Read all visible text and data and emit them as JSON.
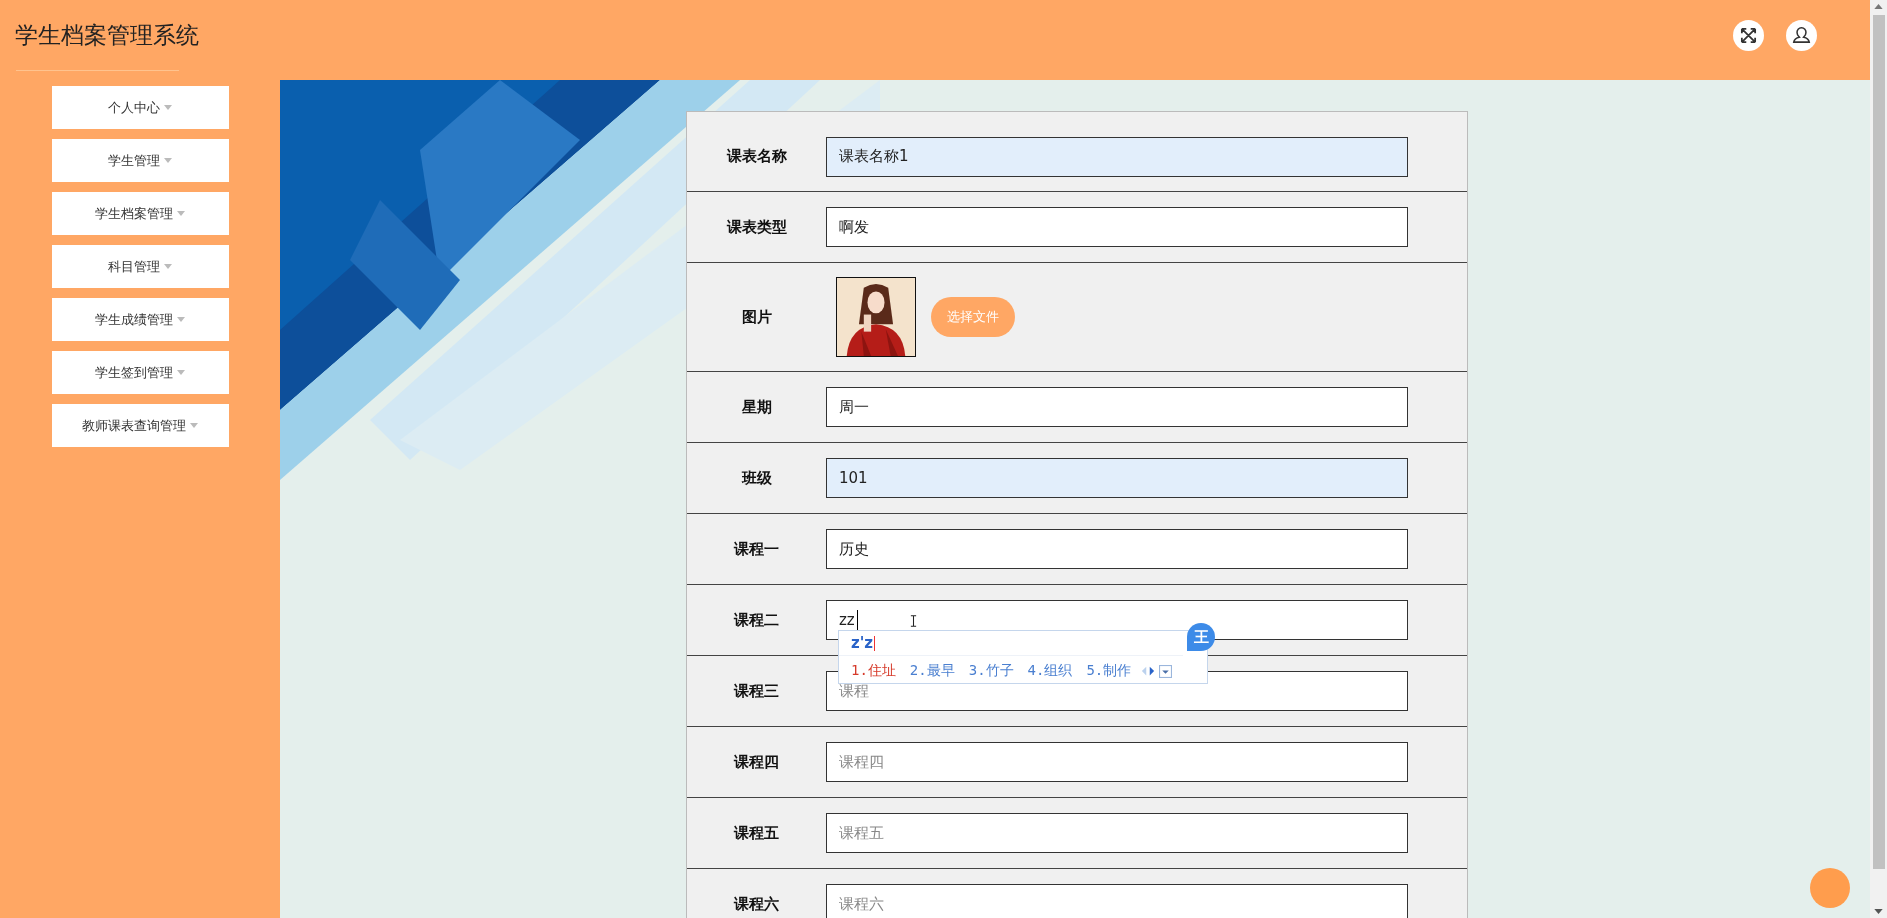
{
  "header": {
    "title": "学生档案管理系统"
  },
  "sidebar": {
    "items": [
      {
        "label": "个人中心"
      },
      {
        "label": "学生管理"
      },
      {
        "label": "学生档案管理"
      },
      {
        "label": "科目管理"
      },
      {
        "label": "学生成绩管理"
      },
      {
        "label": "学生签到管理"
      },
      {
        "label": "教师课表查询管理"
      }
    ]
  },
  "form": {
    "rows": [
      {
        "kind": "input",
        "label": "课表名称",
        "value": "课表名称1",
        "autofilled": true,
        "focused": false
      },
      {
        "kind": "input",
        "label": "课表类型",
        "value": "啊发",
        "autofilled": false,
        "focused": false
      },
      {
        "label": "图片",
        "button": "选择文件"
      },
      {
        "kind": "input",
        "label": "星期",
        "value": "周一",
        "autofilled": false,
        "focused": false
      },
      {
        "kind": "input",
        "label": "班级",
        "value": "101",
        "autofilled": true,
        "focused": false
      },
      {
        "kind": "input",
        "label": "课程一",
        "value": "历史",
        "autofilled": false,
        "focused": false
      },
      {
        "kind": "input",
        "label": "课程二",
        "value": "zz",
        "autofilled": false,
        "focused": true
      },
      {
        "kind": "input",
        "label": "课程三",
        "placeholder": "课程",
        "autofilled": false,
        "focused": false
      },
      {
        "kind": "input",
        "label": "课程四",
        "placeholder": "课程四",
        "autofilled": false,
        "focused": false
      },
      {
        "kind": "input",
        "label": "课程五",
        "placeholder": "课程五",
        "autofilled": false,
        "focused": false
      },
      {
        "kind": "input",
        "label": "课程六",
        "placeholder": "课程六",
        "autofilled": false,
        "focused": false
      }
    ]
  },
  "ime": {
    "composition": "z'z",
    "logo": "王",
    "candidates": [
      {
        "label": "1.住址",
        "selected": true
      },
      {
        "label": "2.最早",
        "selected": false
      },
      {
        "label": "3.竹子",
        "selected": false
      },
      {
        "label": "4.组织",
        "selected": false
      },
      {
        "label": "5.制作",
        "selected": false
      }
    ]
  }
}
